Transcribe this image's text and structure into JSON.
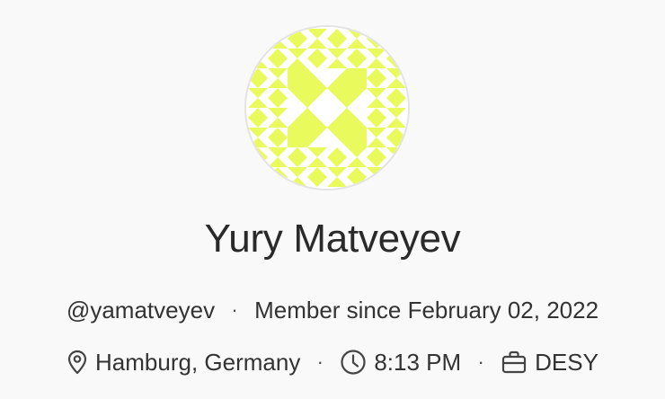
{
  "profile": {
    "name": "Yury Matveyev",
    "username": "@yamatveyev",
    "member_since": "Member since February 02, 2022",
    "location": "Hamburg, Germany",
    "local_time": "8:13 PM",
    "organization": "DESY",
    "separator": "·"
  },
  "icons": {
    "location": "map-pin-icon",
    "time": "clock-icon",
    "organization": "briefcase-icon"
  },
  "colors": {
    "avatar_pattern": "#e8fa5c",
    "avatar_background": "#ffffff",
    "text": "#2b2b2b",
    "page_background": "#f9f9f9"
  }
}
